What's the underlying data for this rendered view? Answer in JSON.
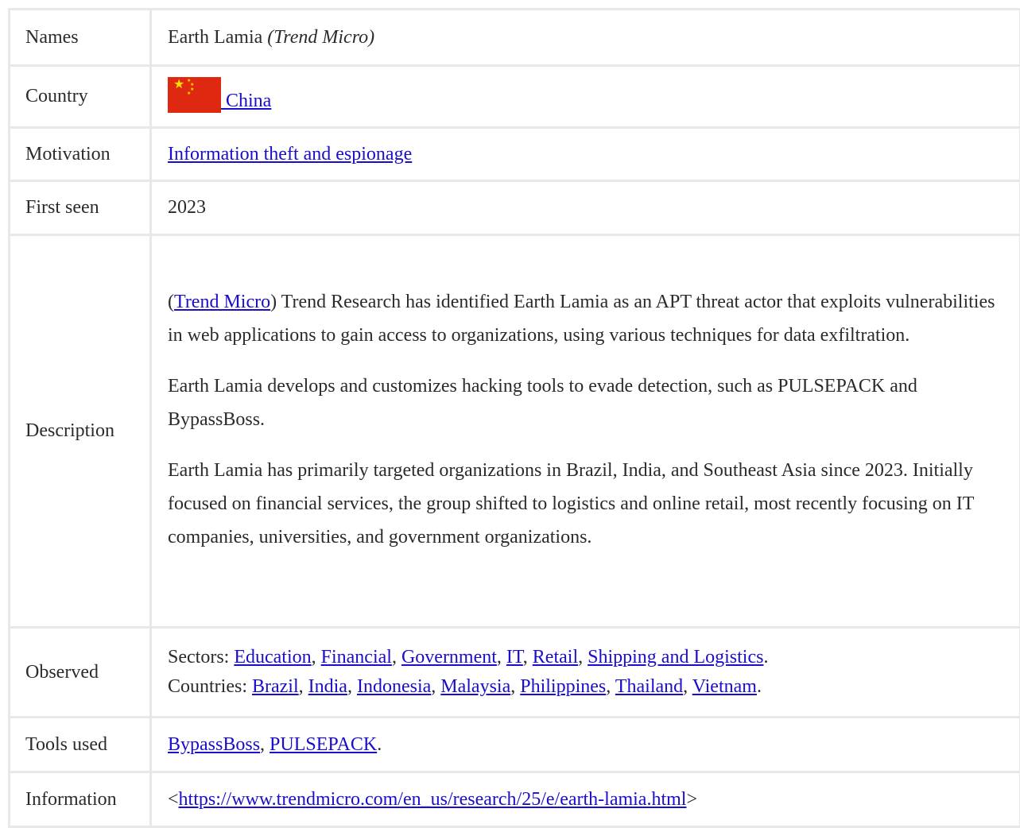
{
  "rows": {
    "names": {
      "label": "Names",
      "value": "Earth Lamia",
      "note": "(Trend Micro)"
    },
    "country": {
      "label": "Country",
      "flag_icon": "china-flag",
      "link": " China"
    },
    "motivation": {
      "label": "Motivation",
      "link": "Information theft and espionage"
    },
    "first_seen": {
      "label": "First seen",
      "value": "2023"
    },
    "description": {
      "label": "Description",
      "source_open": "(",
      "source_link": "Trend Micro",
      "p1_rest": ") Trend Research has identified Earth Lamia as an APT threat actor that exploits vulnerabilities in web applications to gain access to organizations, using various techniques for data exfiltration.",
      "p2": "Earth Lamia develops and customizes hacking tools to evade detection, such as PULSEPACK and BypassBoss.",
      "p3": "Earth Lamia has primarily targeted organizations in Brazil, India, and Southeast Asia since 2023. Initially focused on financial services, the group shifted to logistics and online retail, most recently focusing on IT companies, universities, and government organizations."
    },
    "observed": {
      "label": "Observed",
      "sectors_prefix": "Sectors: ",
      "sectors": [
        "Education",
        "Financial",
        "Government",
        "IT",
        "Retail",
        "Shipping and Logistics"
      ],
      "countries_prefix": "Countries: ",
      "countries": [
        "Brazil",
        "India",
        "Indonesia",
        "Malaysia",
        "Philippines",
        "Thailand",
        "Vietnam"
      ],
      "separator": ", ",
      "end": "."
    },
    "tools": {
      "label": "Tools used",
      "items": [
        "BypassBoss",
        "PULSEPACK"
      ],
      "separator": ", ",
      "end": "."
    },
    "information": {
      "label": "Information",
      "open": "<",
      "link": "https://www.trendmicro.com/en_us/research/25/e/earth-lamia.html",
      "close": ">"
    }
  },
  "colors": {
    "link": "#1a0dcc",
    "border": "#e8e8e8",
    "text": "#2b2b2b",
    "flag_red": "#de2910",
    "flag_star": "#ffde00"
  }
}
